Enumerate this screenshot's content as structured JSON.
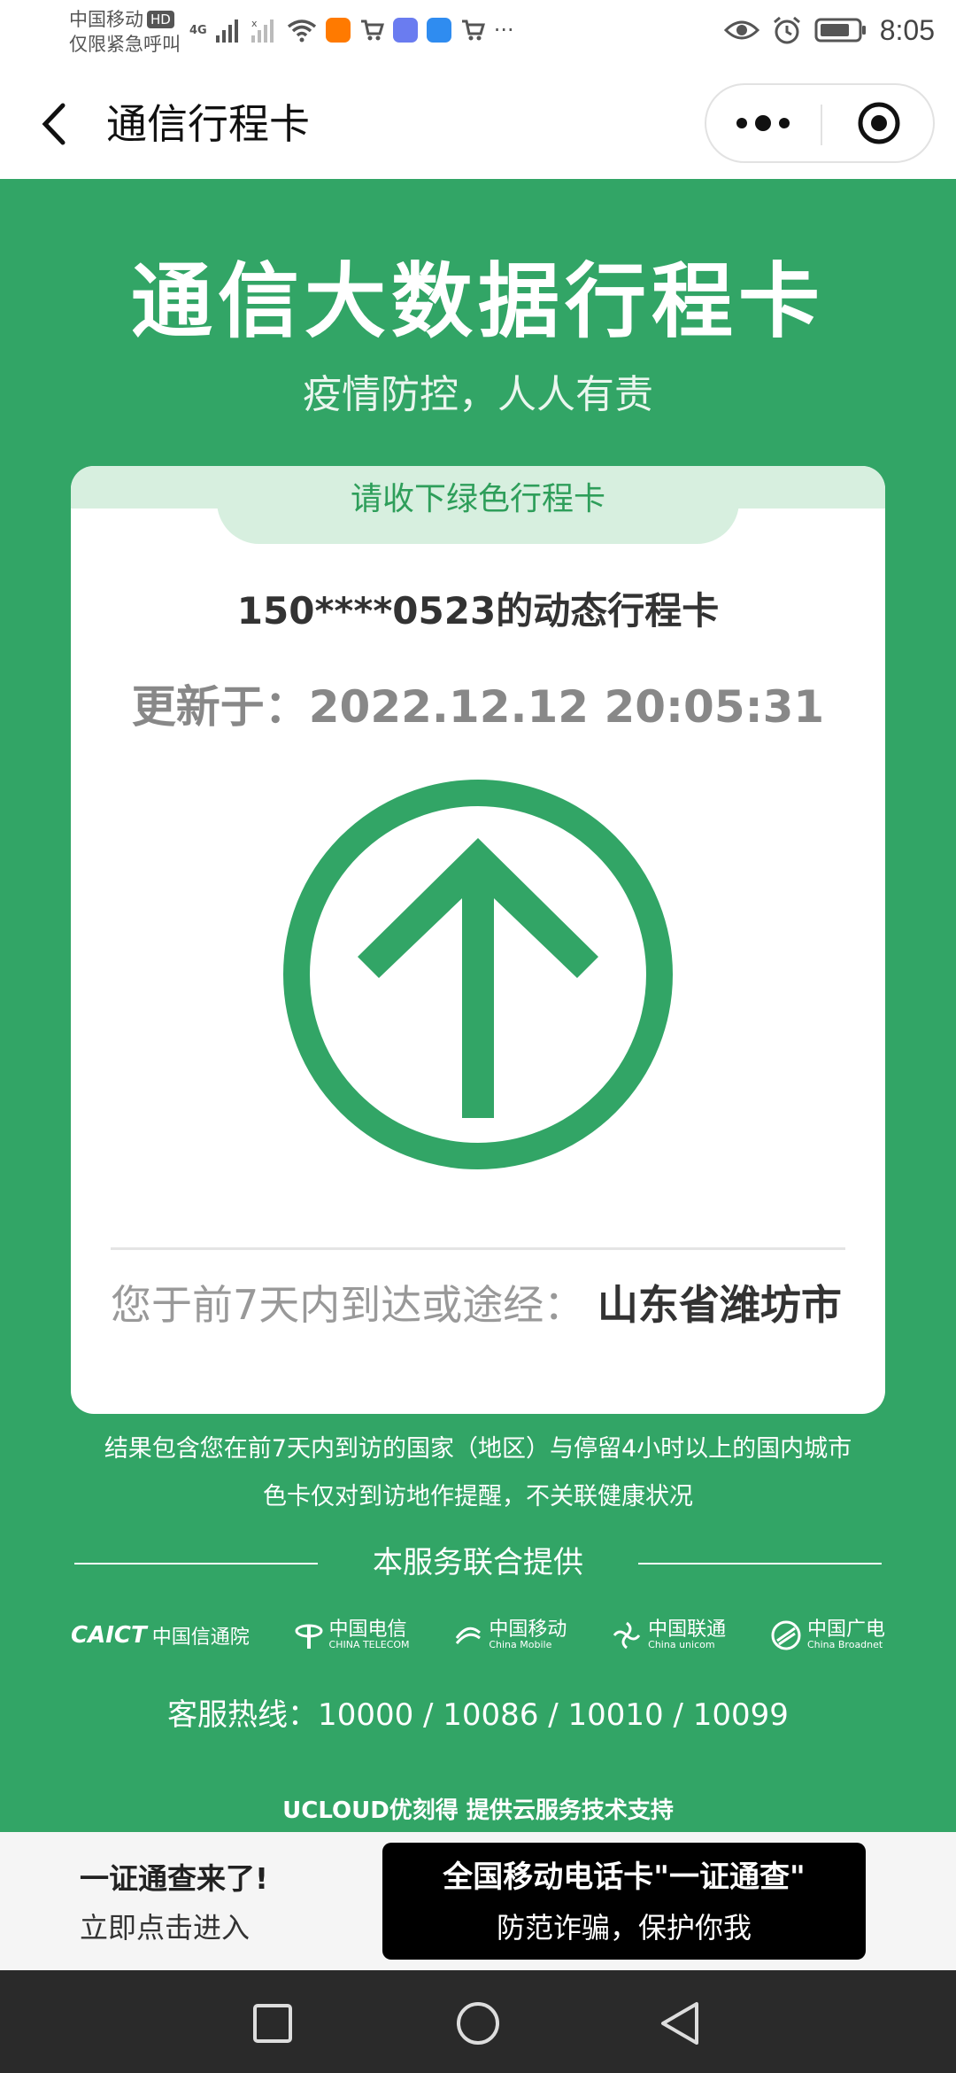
{
  "status_bar": {
    "carrier_line1": "中国移动",
    "hd_badge": "HD",
    "carrier_line2": "仅限紧急呼叫",
    "network": "4G",
    "more": "···",
    "time": "8:05",
    "icons_left": [
      "signal-icon",
      "signal-off-icon",
      "wifi-icon",
      "taobao-icon",
      "cart-icon",
      "app-icon",
      "cloud-icon",
      "cart-icon"
    ],
    "icons_right": [
      "eye-icon",
      "alarm-icon",
      "battery-icon"
    ]
  },
  "nav": {
    "title": "通信行程卡"
  },
  "main": {
    "headline": "通信大数据行程卡",
    "slogan": "疫情防控，人人有责",
    "card": {
      "tab_label": "请收下绿色行程卡",
      "phone_title": "150****0523的动态行程卡",
      "update_time": "更新于：2022.12.12 20:05:31",
      "route_prefix": "您于前7天内到达或途经：",
      "route_places": "山东省潍坊市",
      "status_color": "#32a566"
    },
    "note_line1": "结果包含您在前7天内到访的国家（地区）与停留4小时以上的国内城市",
    "note_line2": "色卡仅对到访地作提醒，不关联健康状况",
    "provider_label": "本服务联合提供",
    "logos": {
      "caict_mark": "CAICT",
      "caict_name": "中国信通院",
      "telecom_name": "中国电信",
      "telecom_en": "CHINA TELECOM",
      "mobile_name": "中国移动",
      "mobile_en": "China Mobile",
      "unicom_name": "中国联通",
      "unicom_en": "China unicom",
      "broadnet_name": "中国广电",
      "broadnet_en": "China Broadnet"
    },
    "hotline": "客服热线：10000 / 10086 / 10010 / 10099",
    "ucloud": "UCLOUD优刻得 提供云服务技术支持"
  },
  "banner": {
    "title": "一证通查来了!",
    "subtitle": "立即点击进入",
    "ad_title": "全国移动电话卡\"一证通查\"",
    "ad_subtitle": "防范诈骗，保护你我"
  },
  "colors": {
    "brand_green": "#32a566",
    "tab_green": "#d7efdf",
    "tab_text": "#2e9e5a"
  }
}
